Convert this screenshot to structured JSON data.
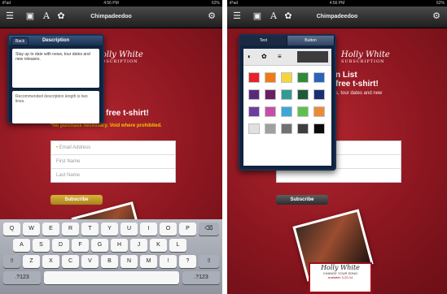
{
  "status": {
    "carrier": "iPad",
    "time": "4:56 PM",
    "battery": "62%"
  },
  "toolbar": {
    "title": "Chimpadeedoo"
  },
  "icons": {
    "list": "list-icon",
    "image": "image-icon",
    "text": "text-icon",
    "palette": "palette-icon",
    "settings": "gear-icon"
  },
  "page": {
    "logo_name": "Holly White",
    "logo_sub": "SUBSCRIPTION",
    "heading_left": "free t-shirt!",
    "heading_right_1": "n List",
    "heading_right_2": "free t-shirt!",
    "subtext_right": "s, tour dates and new",
    "warning": "*No purchase necessary. Void where prohibited.",
    "email_placeholder": "Email Address",
    "first_name_placeholder": "First Name",
    "last_name_placeholder": "Last Name",
    "subscribe_label": "Subscribe"
  },
  "description_popover": {
    "back_label": "Back",
    "title": "Description",
    "value": "Stay up to date with news, tour dates and new releases.",
    "hint": "Recommended description length is two lines."
  },
  "color_popover": {
    "tabs": [
      {
        "label": "Text"
      },
      {
        "label": "Button"
      }
    ],
    "selected_tab": "Button",
    "swatches": [
      [
        "#e8222a",
        "#f07a17",
        "#f4d63b",
        "#2f8a3a",
        "#2a63b8"
      ],
      [
        "#5a2a7a",
        "#6a1f62",
        "#2f9b94",
        "#1e5a34",
        "#1c2e73"
      ],
      [
        "#6d3d9e",
        "#c64ea8",
        "#3da6d8",
        "#5cc04e",
        "#e88b3a"
      ],
      [
        "#e0e0e0",
        "#a0a0a0",
        "#707070",
        "#3e3e3e",
        "#0a0a0a"
      ]
    ],
    "selected_color": "#3c3c3c"
  },
  "keyboard": {
    "row1": [
      "Q",
      "W",
      "E",
      "R",
      "T",
      "Y",
      "U",
      "I",
      "O",
      "P"
    ],
    "row2": [
      "A",
      "S",
      "D",
      "F",
      "G",
      "H",
      "J",
      "K",
      "L"
    ],
    "row3": [
      "Z",
      "X",
      "C",
      "V",
      "B",
      "N",
      "M",
      "!",
      "?"
    ],
    "numbers": ".?123",
    "space": ""
  },
  "card": {
    "name": "Holly White",
    "tag": "CHANGE YOUR SONG",
    "date": "available 3-20-14"
  }
}
